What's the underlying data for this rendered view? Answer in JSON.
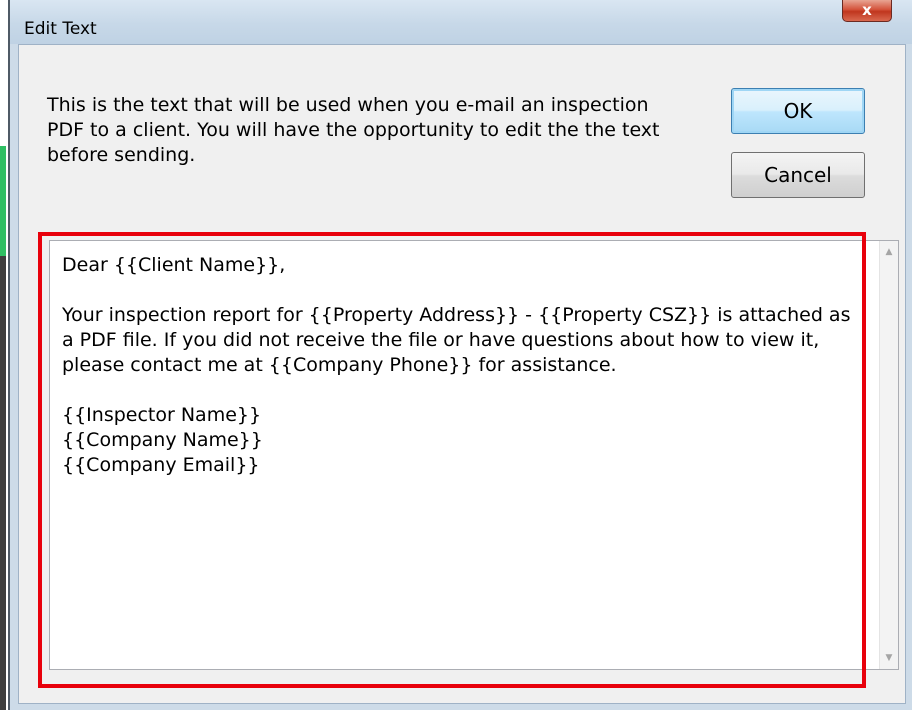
{
  "window": {
    "title": "Edit Text",
    "close_label": "x"
  },
  "description": "This is the text that will be used when you e-mail an inspection PDF to a client. You will have the opportunity to edit the the text before sending.",
  "buttons": {
    "ok_label": "OK",
    "cancel_label": "Cancel"
  },
  "editor": {
    "value": "Dear {{Client Name}},\n\nYour inspection report for {{Property Address}} - {{Property CSZ}} is attached as a PDF file. If you did not receive the file or have questions about how to view it, please contact me at {{Company Phone}} for assistance.\n\n{{Inspector Name}}\n{{Company Name}}\n{{Company Email}}"
  },
  "scrollbar": {
    "up_icon": "scroll-up-arrow-icon",
    "down_icon": "scroll-down-arrow-icon"
  },
  "colors": {
    "highlight": "#e8000b",
    "close_button": "#c0361e",
    "default_button_border": "#3c7fb1"
  }
}
